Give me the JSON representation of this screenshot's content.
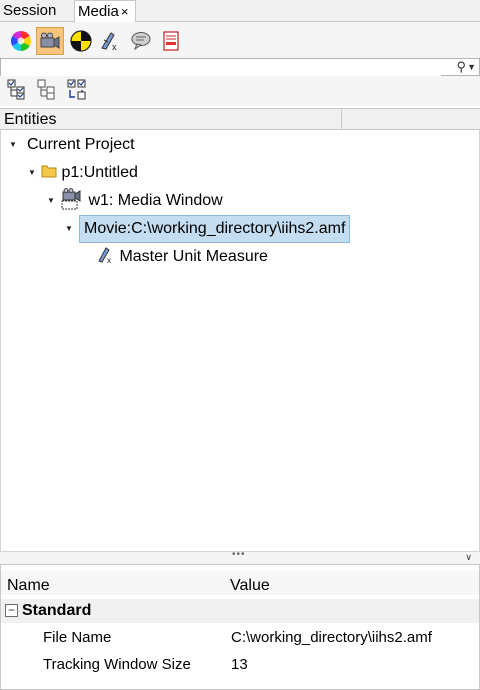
{
  "tabs": [
    {
      "label": "Session"
    },
    {
      "label": "Media",
      "close": "×"
    }
  ],
  "toolbar": {
    "icons": [
      "color-wheel-icon",
      "camera-icon",
      "target-marker-icon",
      "unit-measure-icon",
      "comment-icon",
      "document-icon"
    ],
    "active_index": 1
  },
  "search": {
    "placeholder": "",
    "value": ""
  },
  "entities": {
    "header": "Entities",
    "tree": [
      {
        "label": "Current Project",
        "level": 0,
        "icon": null,
        "expanded": true
      },
      {
        "label": "p1:Untitled",
        "level": 1,
        "icon": "folder-icon",
        "expanded": true
      },
      {
        "label": "w1: Media Window",
        "level": 2,
        "icon": "media-window-icon",
        "expanded": true
      },
      {
        "label": "Movie:C:\\working_directory\\iihs2.amf",
        "level": 3,
        "icon": null,
        "expanded": true,
        "selected": true
      },
      {
        "label": "Master Unit Measure",
        "level": 4,
        "icon": "unit-measure-icon",
        "expanded": null
      }
    ]
  },
  "properties": {
    "col_name": "Name",
    "col_value": "Value",
    "group": {
      "label": "Standard",
      "toggle": "−"
    },
    "rows": [
      {
        "name": "File Name",
        "value": "C:\\working_directory\\iihs2.amf"
      },
      {
        "name": "Tracking Window Size",
        "value": "13"
      }
    ]
  },
  "colors": {
    "selection": "#c4ddf0",
    "active_tool": "#f6c47a"
  }
}
